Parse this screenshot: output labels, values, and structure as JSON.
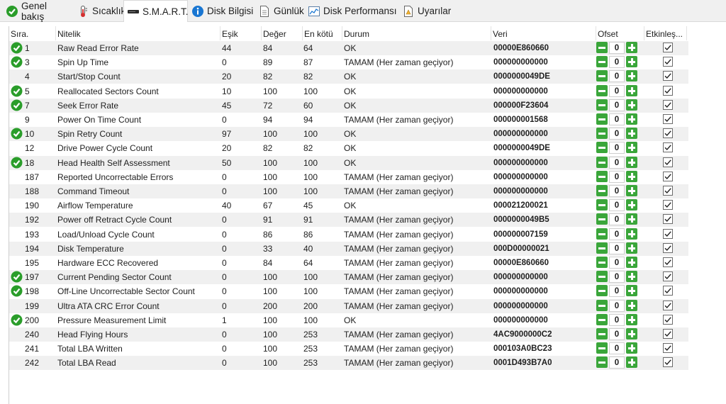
{
  "tabs": [
    {
      "label": "Genel bakış",
      "icon": "check-circle-icon",
      "active": false
    },
    {
      "label": "Sıcaklık",
      "icon": "thermometer-icon",
      "active": false
    },
    {
      "label": "S.M.A.R.T.",
      "icon": "drive-icon",
      "active": true
    },
    {
      "label": "Disk Bilgisi",
      "icon": "info-icon",
      "active": false
    },
    {
      "label": "Günlük",
      "icon": "document-icon",
      "active": false
    },
    {
      "label": "Disk Performansı",
      "icon": "chart-icon",
      "active": false
    },
    {
      "label": "Uyarılar",
      "icon": "warning-document-icon",
      "active": false
    }
  ],
  "columns": [
    "Sıra.",
    "Nitelik",
    "Eşik",
    "Değer",
    "En kötü",
    "Durum",
    "Veri",
    "Ofset",
    "Etkinleş..."
  ],
  "rows": [
    {
      "id": "1",
      "name": "Raw Read Error Rate",
      "threshold": "44",
      "value": "84",
      "worst": "64",
      "status": "OK",
      "data": "00000E860660",
      "offset": "0",
      "ok_icon": true
    },
    {
      "id": "3",
      "name": "Spin Up Time",
      "threshold": "0",
      "value": "89",
      "worst": "87",
      "status": "TAMAM (Her zaman geçiyor)",
      "data": "000000000000",
      "offset": "0",
      "ok_icon": true
    },
    {
      "id": "4",
      "name": "Start/Stop Count",
      "threshold": "20",
      "value": "82",
      "worst": "82",
      "status": "OK",
      "data": "0000000049DE",
      "offset": "0",
      "ok_icon": false
    },
    {
      "id": "5",
      "name": "Reallocated Sectors Count",
      "threshold": "10",
      "value": "100",
      "worst": "100",
      "status": "OK",
      "data": "000000000000",
      "offset": "0",
      "ok_icon": true
    },
    {
      "id": "7",
      "name": "Seek Error Rate",
      "threshold": "45",
      "value": "72",
      "worst": "60",
      "status": "OK",
      "data": "000000F23604",
      "offset": "0",
      "ok_icon": true
    },
    {
      "id": "9",
      "name": "Power On Time Count",
      "threshold": "0",
      "value": "94",
      "worst": "94",
      "status": "TAMAM (Her zaman geçiyor)",
      "data": "000000001568",
      "offset": "0",
      "ok_icon": false
    },
    {
      "id": "10",
      "name": "Spin Retry Count",
      "threshold": "97",
      "value": "100",
      "worst": "100",
      "status": "OK",
      "data": "000000000000",
      "offset": "0",
      "ok_icon": true
    },
    {
      "id": "12",
      "name": "Drive Power Cycle Count",
      "threshold": "20",
      "value": "82",
      "worst": "82",
      "status": "OK",
      "data": "0000000049DE",
      "offset": "0",
      "ok_icon": false
    },
    {
      "id": "18",
      "name": "Head Health Self Assessment",
      "threshold": "50",
      "value": "100",
      "worst": "100",
      "status": "OK",
      "data": "000000000000",
      "offset": "0",
      "ok_icon": true
    },
    {
      "id": "187",
      "name": "Reported Uncorrectable Errors",
      "threshold": "0",
      "value": "100",
      "worst": "100",
      "status": "TAMAM (Her zaman geçiyor)",
      "data": "000000000000",
      "offset": "0",
      "ok_icon": false
    },
    {
      "id": "188",
      "name": "Command Timeout",
      "threshold": "0",
      "value": "100",
      "worst": "100",
      "status": "TAMAM (Her zaman geçiyor)",
      "data": "000000000000",
      "offset": "0",
      "ok_icon": false
    },
    {
      "id": "190",
      "name": "Airflow Temperature",
      "threshold": "40",
      "value": "67",
      "worst": "45",
      "status": "OK",
      "data": "000021200021",
      "offset": "0",
      "ok_icon": false
    },
    {
      "id": "192",
      "name": "Power off Retract Cycle Count",
      "threshold": "0",
      "value": "91",
      "worst": "91",
      "status": "TAMAM (Her zaman geçiyor)",
      "data": "0000000049B5",
      "offset": "0",
      "ok_icon": false
    },
    {
      "id": "193",
      "name": "Load/Unload Cycle Count",
      "threshold": "0",
      "value": "86",
      "worst": "86",
      "status": "TAMAM (Her zaman geçiyor)",
      "data": "000000007159",
      "offset": "0",
      "ok_icon": false
    },
    {
      "id": "194",
      "name": "Disk Temperature",
      "threshold": "0",
      "value": "33",
      "worst": "40",
      "status": "TAMAM (Her zaman geçiyor)",
      "data": "000D00000021",
      "offset": "0",
      "ok_icon": false
    },
    {
      "id": "195",
      "name": "Hardware ECC Recovered",
      "threshold": "0",
      "value": "84",
      "worst": "64",
      "status": "TAMAM (Her zaman geçiyor)",
      "data": "00000E860660",
      "offset": "0",
      "ok_icon": false
    },
    {
      "id": "197",
      "name": "Current Pending Sector Count",
      "threshold": "0",
      "value": "100",
      "worst": "100",
      "status": "TAMAM (Her zaman geçiyor)",
      "data": "000000000000",
      "offset": "0",
      "ok_icon": true
    },
    {
      "id": "198",
      "name": "Off-Line Uncorrectable Sector Count",
      "threshold": "0",
      "value": "100",
      "worst": "100",
      "status": "TAMAM (Her zaman geçiyor)",
      "data": "000000000000",
      "offset": "0",
      "ok_icon": true
    },
    {
      "id": "199",
      "name": "Ultra ATA CRC Error Count",
      "threshold": "0",
      "value": "200",
      "worst": "200",
      "status": "TAMAM (Her zaman geçiyor)",
      "data": "000000000000",
      "offset": "0",
      "ok_icon": false
    },
    {
      "id": "200",
      "name": "Pressure Measurement Limit",
      "threshold": "1",
      "value": "100",
      "worst": "100",
      "status": "OK",
      "data": "000000000000",
      "offset": "0",
      "ok_icon": true
    },
    {
      "id": "240",
      "name": "Head Flying Hours",
      "threshold": "0",
      "value": "100",
      "worst": "253",
      "status": "TAMAM (Her zaman geçiyor)",
      "data": "4AC9000000C2",
      "offset": "0",
      "ok_icon": false
    },
    {
      "id": "241",
      "name": "Total LBA Written",
      "threshold": "0",
      "value": "100",
      "worst": "253",
      "status": "TAMAM (Her zaman geçiyor)",
      "data": "000103A0BC23",
      "offset": "0",
      "ok_icon": false
    },
    {
      "id": "242",
      "name": "Total LBA Read",
      "threshold": "0",
      "value": "100",
      "worst": "253",
      "status": "TAMAM (Her zaman geçiyor)",
      "data": "0001D493B7A0",
      "offset": "0",
      "ok_icon": false
    }
  ],
  "colors": {
    "ok_green": "#2a9d2a",
    "button_green": "#3aa63a",
    "alt_row": "#f0f0f0"
  }
}
